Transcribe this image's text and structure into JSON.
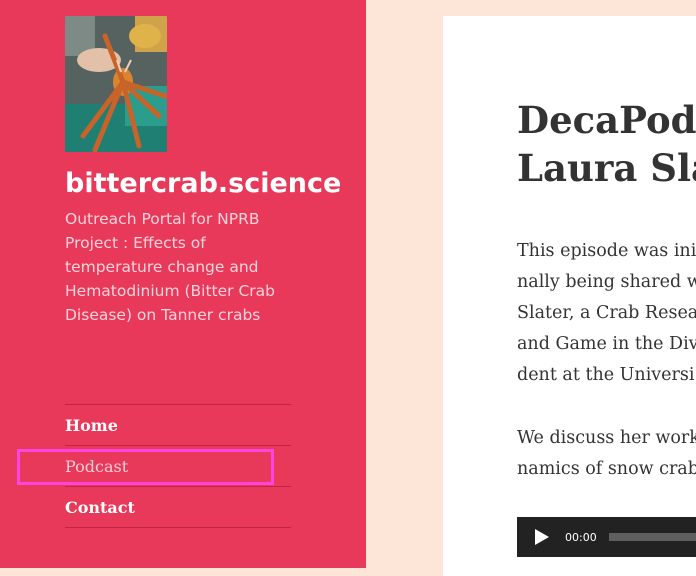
{
  "sidebar": {
    "site_title": "bittercrab.science",
    "description": "Outreach Portal for NPRB Project : Effects of temperature change and Hematodinium (Bitter Crab Disease) on Tanner crabs",
    "nav": [
      {
        "label": "Home"
      },
      {
        "label": "Podcast"
      },
      {
        "label": "Contact"
      }
    ]
  },
  "article": {
    "title_lines": [
      "DecaPod",
      "Laura Sla"
    ],
    "paragraph1_lines": [
      "This episode was ini",
      "nally being shared w",
      "Slater, a Crab Resear",
      "and Game in the Div",
      "dent at the Universi"
    ],
    "paragraph2_lines": [
      "We discuss her work",
      "namics of snow crab"
    ],
    "audio": {
      "time": "00:00",
      "progress": 0
    }
  },
  "colors": {
    "sidebar_bg": "#e8395a",
    "page_bg": "#fde5d8",
    "highlight": "#ff44e0"
  }
}
